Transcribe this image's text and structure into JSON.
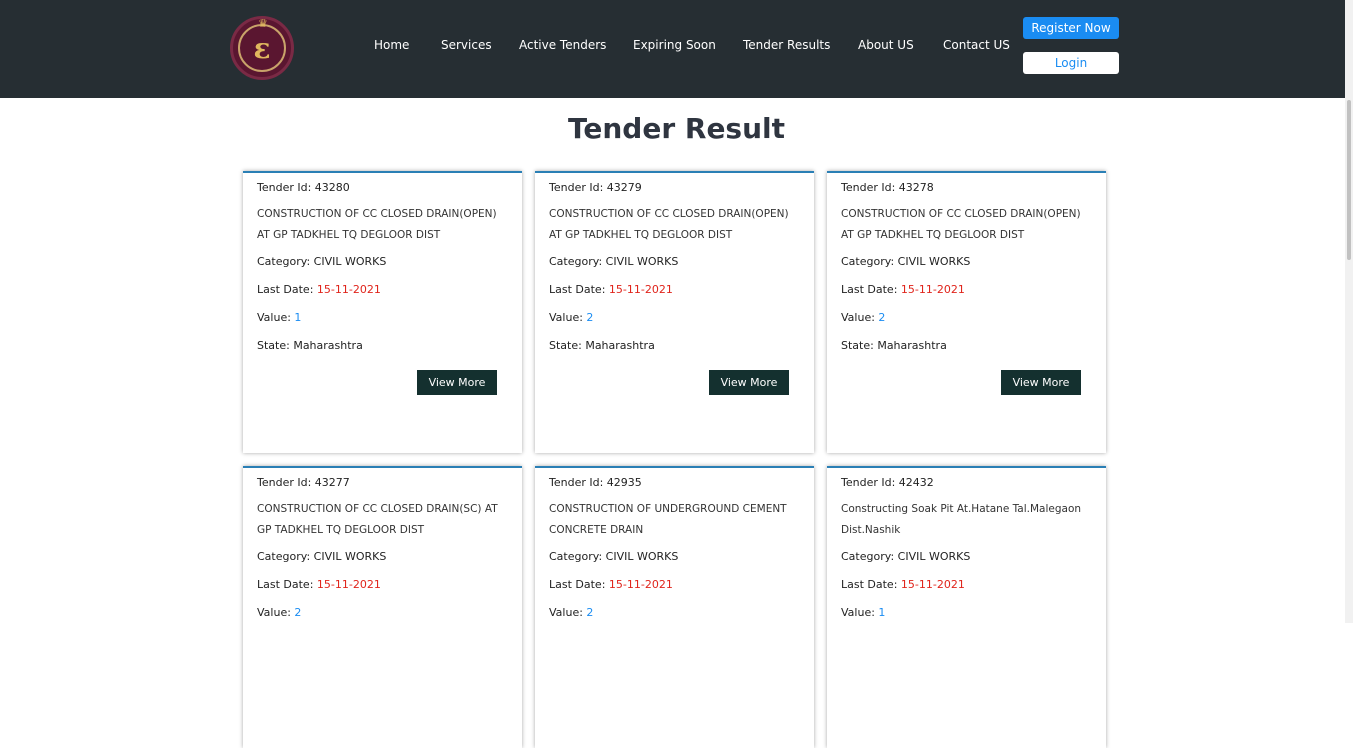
{
  "brand": {
    "logo_glyph": "ɛ"
  },
  "nav": {
    "items": [
      "Home",
      "Services",
      "Active Tenders",
      "Expiring Soon",
      "Tender Results",
      "About US",
      "Contact US"
    ],
    "register_label": "Register Now",
    "login_label": "Login"
  },
  "page_title": "Tender Result",
  "labels": {
    "tender_id": "Tender Id: ",
    "category": "Category: ",
    "last_date": "Last Date: ",
    "value": "Value: ",
    "state": "State: ",
    "view_more": "View More"
  },
  "colors": {
    "header_bg": "#262e33",
    "accent_blue": "#1a8cf2",
    "date_red": "#e0241b",
    "button_dark": "#14302f"
  },
  "tenders": [
    {
      "id": "43280",
      "description": "CONSTRUCTION OF CC CLOSED DRAIN(OPEN) AT GP TADKHEL TQ DEGLOOR DIST",
      "category": "CIVIL WORKS",
      "last_date": "15-11-2021",
      "value": "1",
      "state": "Maharashtra"
    },
    {
      "id": "43279",
      "description": "CONSTRUCTION OF CC CLOSED DRAIN(OPEN) AT GP TADKHEL TQ DEGLOOR DIST",
      "category": "CIVIL WORKS",
      "last_date": "15-11-2021",
      "value": "2",
      "state": "Maharashtra"
    },
    {
      "id": "43278",
      "description": "CONSTRUCTION OF CC CLOSED DRAIN(OPEN) AT GP TADKHEL TQ DEGLOOR DIST",
      "category": "CIVIL WORKS",
      "last_date": "15-11-2021",
      "value": "2",
      "state": "Maharashtra"
    },
    {
      "id": "43277",
      "description": "CONSTRUCTION OF CC CLOSED DRAIN(SC) AT GP TADKHEL TQ DEGLOOR DIST",
      "category": "CIVIL WORKS",
      "last_date": "15-11-2021",
      "value": "2",
      "state": ""
    },
    {
      "id": "42935",
      "description": "CONSTRUCTION OF UNDERGROUND CEMENT CONCRETE DRAIN",
      "category": "CIVIL WORKS",
      "last_date": "15-11-2021",
      "value": "2",
      "state": ""
    },
    {
      "id": "42432",
      "description": "Constructing Soak Pit At.Hatane Tal.Malegaon Dist.Nashik",
      "category": "CIVIL WORKS",
      "last_date": "15-11-2021",
      "value": "1",
      "state": ""
    }
  ]
}
